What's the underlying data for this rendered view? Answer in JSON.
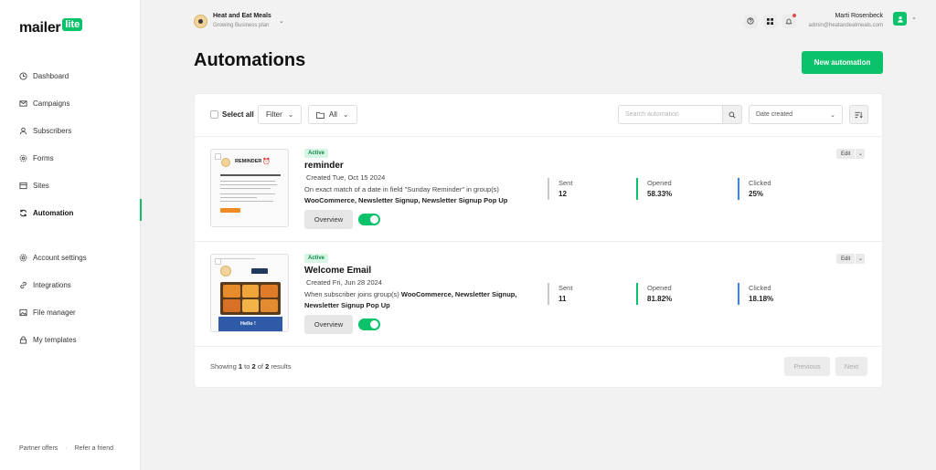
{
  "brand": {
    "word": "mailer",
    "badge": "lite"
  },
  "sidebar": {
    "items": [
      {
        "label": "Dashboard",
        "icon": "clock-icon"
      },
      {
        "label": "Campaigns",
        "icon": "mail-icon"
      },
      {
        "label": "Subscribers",
        "icon": "user-icon"
      },
      {
        "label": "Forms",
        "icon": "gear-icon"
      },
      {
        "label": "Sites",
        "icon": "browser-icon"
      },
      {
        "label": "Automation",
        "icon": "refresh-icon"
      }
    ],
    "items2": [
      {
        "label": "Account settings",
        "icon": "settings-icon"
      },
      {
        "label": "Integrations",
        "icon": "link-icon"
      },
      {
        "label": "File manager",
        "icon": "image-icon"
      },
      {
        "label": "My templates",
        "icon": "lock-icon"
      }
    ],
    "footer": {
      "partner": "Partner offers",
      "sep": "·",
      "refer": "Refer a friend"
    }
  },
  "header": {
    "account_name": "Heat and Eat Meals",
    "account_plan": "Growing Business plan",
    "user_name": "Marti Rosenbeck",
    "user_email": "admin@heatandeatmeals.com"
  },
  "page": {
    "title": "Automations",
    "new_button": "New automation"
  },
  "toolbar": {
    "select_all": "Select all",
    "filter": "Filter",
    "all": "All",
    "search_placeholder": "Search automation",
    "date_sort": "Date created"
  },
  "rows": [
    {
      "status": "Active",
      "title": "reminder",
      "created": "Created Tue, Oct 15 2024",
      "desc_prefix": "On exact match of a date in field  \"Sunday Reminder\" in group(s)",
      "desc_groups": "WooCommerce, Newsletter Signup, Newsletter Signup Pop Up",
      "sent_label": "Sent",
      "sent": "12",
      "opened_label": "Opened",
      "opened": "58.33%",
      "clicked_label": "Clicked",
      "clicked": "25%",
      "overview": "Overview",
      "edit": "Edit",
      "thumb_title": "REMINDER"
    },
    {
      "status": "Active",
      "title": "Welcome Email",
      "created": "Created Fri, Jun 28 2024",
      "desc_prefix": "When subscriber joins group(s)",
      "desc_groups": "WooCommerce, Newsletter Signup, Newsletter Signup Pop Up",
      "sent_label": "Sent",
      "sent": "11",
      "opened_label": "Opened",
      "opened": "81.82%",
      "clicked_label": "Clicked",
      "clicked": "18.18%",
      "overview": "Overview",
      "edit": "Edit",
      "thumb_title": "Hello !"
    }
  ],
  "pagination": {
    "showing": "Showing",
    "from": "1",
    "to_word": "to",
    "to": "2",
    "of_word": "of",
    "total": "2",
    "results_word": "results",
    "previous": "Previous",
    "next": "Next"
  },
  "colors": {
    "accent": "#09c269",
    "opened": "#09c269",
    "clicked": "#3b82f6"
  }
}
